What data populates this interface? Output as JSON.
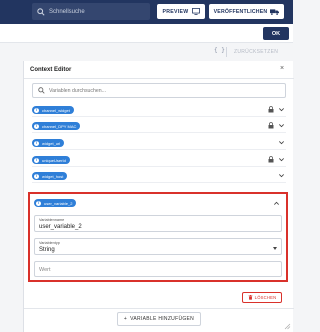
{
  "topbar": {
    "search_placeholder": "Schnellsuche",
    "preview_label": "PREVIEW",
    "publish_label": "VERÖFFENTLICHEN"
  },
  "okbar": {
    "ok_label": "OK"
  },
  "toolbar": {
    "braces_icon": "{ }",
    "reset_label": "ZURÜCKSETZEN"
  },
  "panel": {
    "title": "Context Editor",
    "close_icon": "×",
    "search_placeholder": "Variablen durchsuchen...",
    "variables": [
      {
        "name": "channel_widget",
        "locked": true
      },
      {
        "name": "channel_DPY MAC",
        "locked": true
      },
      {
        "name": "widget_url",
        "locked": false
      },
      {
        "name": "uniqueUserId",
        "locked": true
      },
      {
        "name": "widget_host",
        "locked": false
      }
    ],
    "selected": {
      "name": "user_variable_2",
      "name_label": "Variablenname",
      "name_value": "user_variable_2",
      "type_label": "Variablentyp",
      "type_value": "String",
      "value_placeholder": "Wert"
    },
    "delete_label": "LÖSCHEN",
    "add_label": "VARIABLE HINZUFÜGEN"
  },
  "colors": {
    "navy": "#223560",
    "chip_blue": "#2f7fd8",
    "highlight_red": "#d9312b"
  }
}
